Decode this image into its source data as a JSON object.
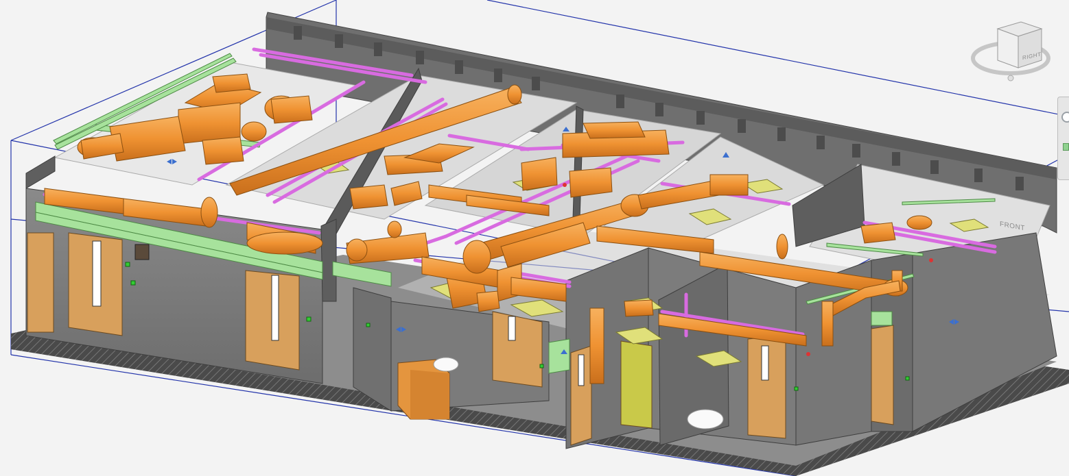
{
  "view": {
    "type": "3D section box view",
    "viewcube": {
      "front_label": "FRONT",
      "right_label": "RIGHT"
    }
  },
  "colors": {
    "background": "#f3f3f3",
    "walls": "#7a7a7a",
    "wall_top": "#6a6a6a",
    "floor": "#8e8e8e",
    "duct": "#f0953d",
    "pipe_magenta": "#d86be0",
    "pipe_green": "#a4e39a",
    "door": "#d8a05c",
    "section_box": "#2233aa",
    "tile": "#e0e07a"
  }
}
